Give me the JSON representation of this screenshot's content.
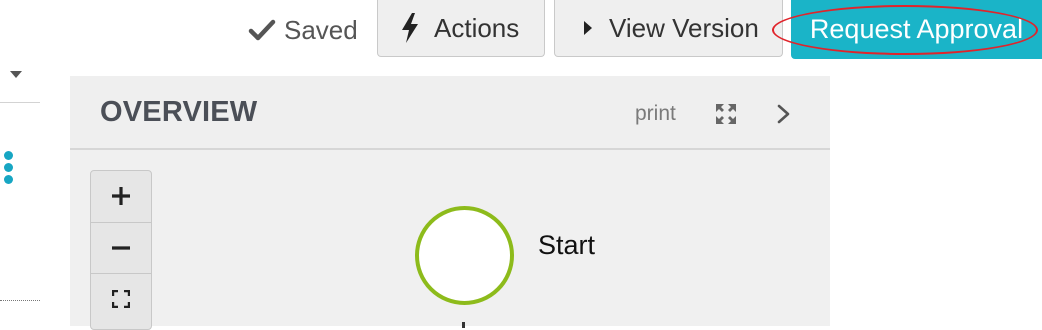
{
  "toolbar": {
    "saved_label": "Saved",
    "actions_label": "Actions",
    "view_version_label": "View Version",
    "request_approval_label": "Request Approval"
  },
  "overview": {
    "title": "OVERVIEW",
    "print_label": "print"
  },
  "diagram": {
    "start_label": "Start"
  },
  "colors": {
    "accent": "#1ab4c8",
    "start_node_border": "#8dbb1b",
    "highlight_ring": "#e0242b",
    "kebab": "#17a6c3"
  },
  "icons": {
    "saved": "checkmark-icon",
    "actions": "lightning-bolt-icon",
    "view_version": "caret-right-icon",
    "expand": "expand-arrows-icon",
    "next": "chevron-right-icon",
    "zoom_in": "plus-icon",
    "zoom_out": "minus-icon",
    "fit": "fit-to-screen-icon",
    "menu": "kebab-menu-icon"
  }
}
